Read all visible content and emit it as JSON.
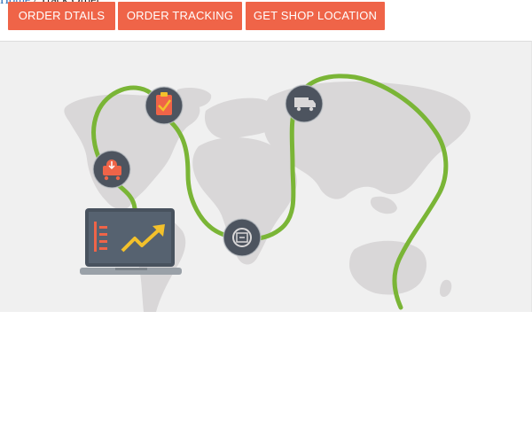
{
  "breadcrumb": {
    "home_label": "Home",
    "separator": "/",
    "current_label": "Track Order"
  },
  "tabs": [
    {
      "label": "ORDER DTAILS"
    },
    {
      "label": "ORDER TRACKING"
    },
    {
      "label": "GET SHOP LOCATION"
    }
  ],
  "tracking_map": {
    "stages": [
      {
        "icon": "delivery-cart-icon"
      },
      {
        "icon": "checklist-icon"
      },
      {
        "icon": "shipment-box-icon"
      },
      {
        "icon": "delivery-truck-icon"
      }
    ],
    "route_color": "#7ab536",
    "continent_color": "#d9d7d8",
    "marker_color": "#4d545f"
  },
  "colors": {
    "tab_background": "#ef6448",
    "tab_text": "#ffffff",
    "panel_background": "#f0f0f0",
    "laptop_screen": "#48525e",
    "chart_arrow": "#f3c12b",
    "chart_bars": "#ef6448"
  }
}
